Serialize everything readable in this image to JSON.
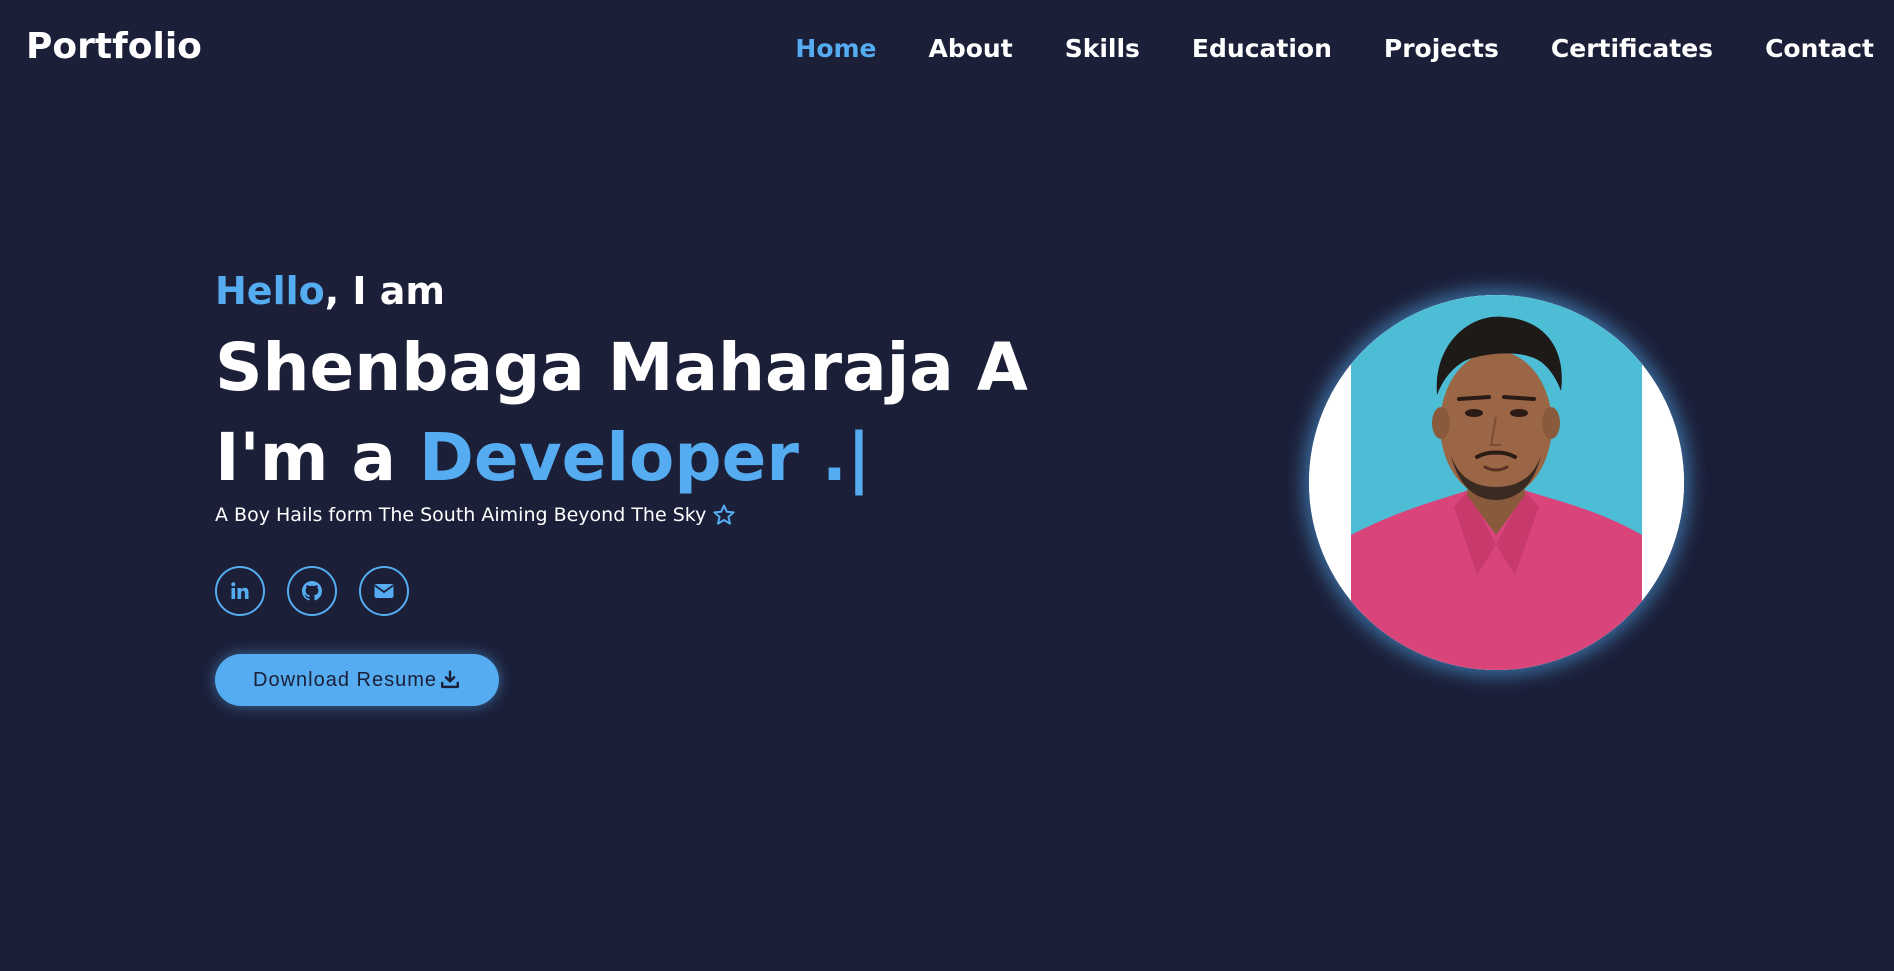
{
  "brand": "Portfolio",
  "nav": {
    "items": [
      {
        "label": "Home",
        "active": true
      },
      {
        "label": "About",
        "active": false
      },
      {
        "label": "Skills",
        "active": false
      },
      {
        "label": "Education",
        "active": false
      },
      {
        "label": "Projects",
        "active": false
      },
      {
        "label": "Certificates",
        "active": false
      },
      {
        "label": "Contact",
        "active": false
      }
    ]
  },
  "hero": {
    "greeting_accent": "Hello",
    "greeting_rest": ", I am",
    "name": "Shenbaga Maharaja A",
    "role_prefix": "I'm a ",
    "role_typed": "Developer .|",
    "tagline": "A Boy Hails form The South Aiming Beyond The Sky",
    "tagline_icon": "star-icon",
    "socials": [
      {
        "name": "linkedin",
        "icon": "linkedin-icon"
      },
      {
        "name": "github",
        "icon": "github-icon"
      },
      {
        "name": "email",
        "icon": "envelope-icon"
      }
    ],
    "resume_label": "Download Resume",
    "resume_icon": "download-icon"
  },
  "colors": {
    "background": "#1b1f38",
    "accent": "#55acf0",
    "text": "#ffffff"
  }
}
